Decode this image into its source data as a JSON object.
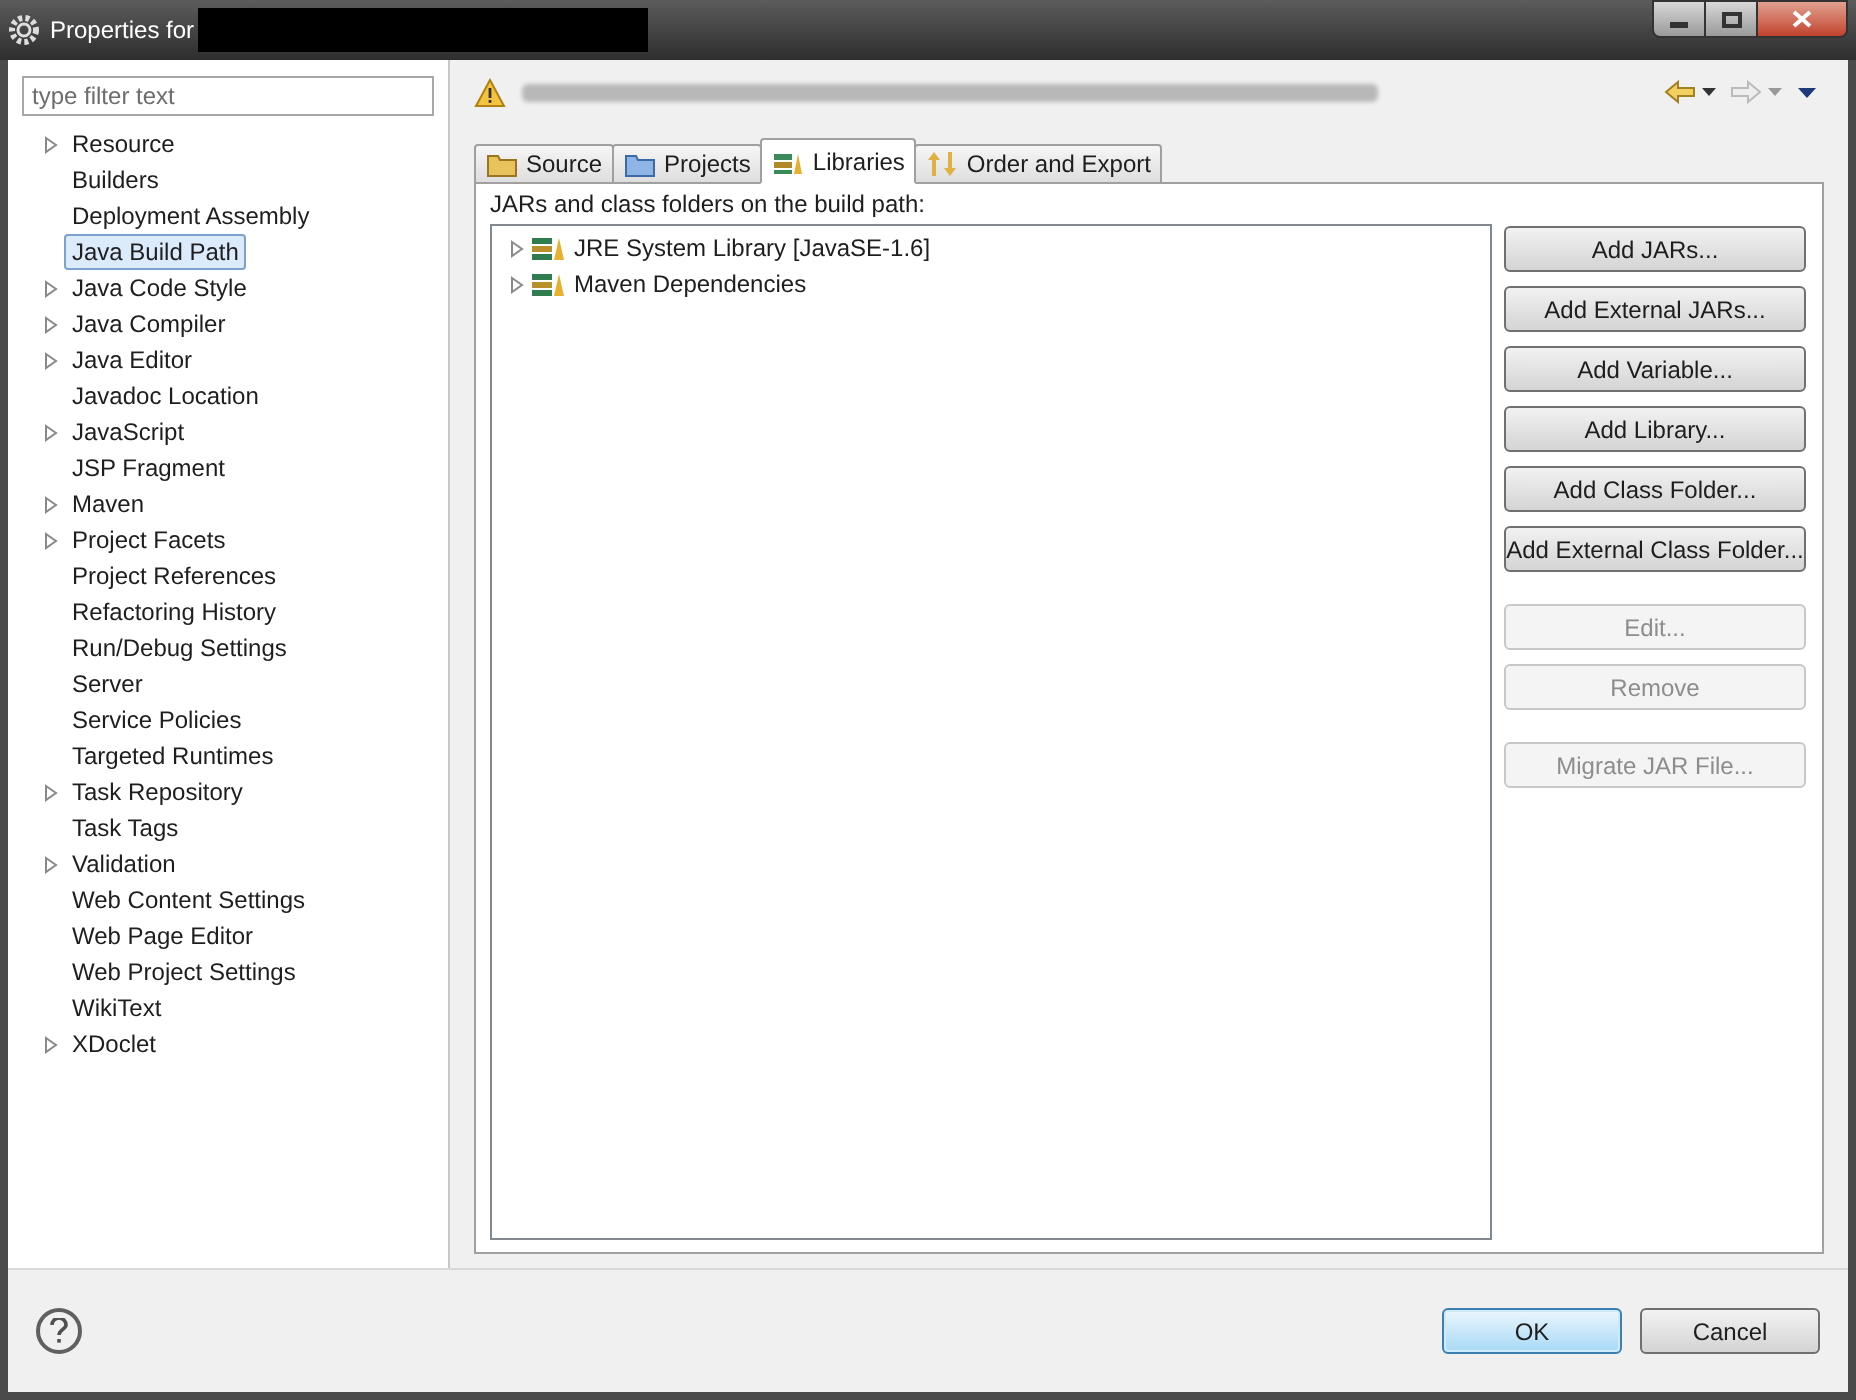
{
  "window": {
    "title": "Properties for"
  },
  "filter": {
    "placeholder": "type filter text"
  },
  "sidebar": {
    "items": [
      {
        "label": "Resource",
        "expandable": true,
        "selected": false
      },
      {
        "label": "Builders",
        "expandable": false,
        "selected": false
      },
      {
        "label": "Deployment Assembly",
        "expandable": false,
        "selected": false
      },
      {
        "label": "Java Build Path",
        "expandable": false,
        "selected": true
      },
      {
        "label": "Java Code Style",
        "expandable": true,
        "selected": false
      },
      {
        "label": "Java Compiler",
        "expandable": true,
        "selected": false
      },
      {
        "label": "Java Editor",
        "expandable": true,
        "selected": false
      },
      {
        "label": "Javadoc Location",
        "expandable": false,
        "selected": false
      },
      {
        "label": "JavaScript",
        "expandable": true,
        "selected": false
      },
      {
        "label": "JSP Fragment",
        "expandable": false,
        "selected": false
      },
      {
        "label": "Maven",
        "expandable": true,
        "selected": false
      },
      {
        "label": "Project Facets",
        "expandable": true,
        "selected": false
      },
      {
        "label": "Project References",
        "expandable": false,
        "selected": false
      },
      {
        "label": "Refactoring History",
        "expandable": false,
        "selected": false
      },
      {
        "label": "Run/Debug Settings",
        "expandable": false,
        "selected": false
      },
      {
        "label": "Server",
        "expandable": false,
        "selected": false
      },
      {
        "label": "Service Policies",
        "expandable": false,
        "selected": false
      },
      {
        "label": "Targeted Runtimes",
        "expandable": false,
        "selected": false
      },
      {
        "label": "Task Repository",
        "expandable": true,
        "selected": false
      },
      {
        "label": "Task Tags",
        "expandable": false,
        "selected": false
      },
      {
        "label": "Validation",
        "expandable": true,
        "selected": false
      },
      {
        "label": "Web Content Settings",
        "expandable": false,
        "selected": false
      },
      {
        "label": "Web Page Editor",
        "expandable": false,
        "selected": false
      },
      {
        "label": "Web Project Settings",
        "expandable": false,
        "selected": false
      },
      {
        "label": "WikiText",
        "expandable": false,
        "selected": false
      },
      {
        "label": "XDoclet",
        "expandable": true,
        "selected": false
      }
    ]
  },
  "tabs": [
    {
      "label": "Source",
      "kind": "source",
      "selected": false
    },
    {
      "label": "Projects",
      "kind": "projects",
      "selected": false
    },
    {
      "label": "Libraries",
      "kind": "libraries",
      "selected": true
    },
    {
      "label": "Order and Export",
      "kind": "order",
      "selected": false
    }
  ],
  "libraries": {
    "heading": "JARs and class folders on the build path:",
    "entries": [
      {
        "label": "JRE System Library [JavaSE-1.6]"
      },
      {
        "label": "Maven Dependencies"
      }
    ]
  },
  "button_groups": [
    [
      {
        "label": "Add JARs...",
        "disabled": false
      },
      {
        "label": "Add External JARs...",
        "disabled": false
      },
      {
        "label": "Add Variable...",
        "disabled": false
      },
      {
        "label": "Add Library...",
        "disabled": false
      },
      {
        "label": "Add Class Folder...",
        "disabled": false
      },
      {
        "label": "Add External Class Folder...",
        "disabled": false
      }
    ],
    [
      {
        "label": "Edit...",
        "disabled": true
      },
      {
        "label": "Remove",
        "disabled": true
      }
    ],
    [
      {
        "label": "Migrate JAR File...",
        "disabled": true
      }
    ]
  ],
  "footer": {
    "ok": "OK",
    "cancel": "Cancel"
  }
}
